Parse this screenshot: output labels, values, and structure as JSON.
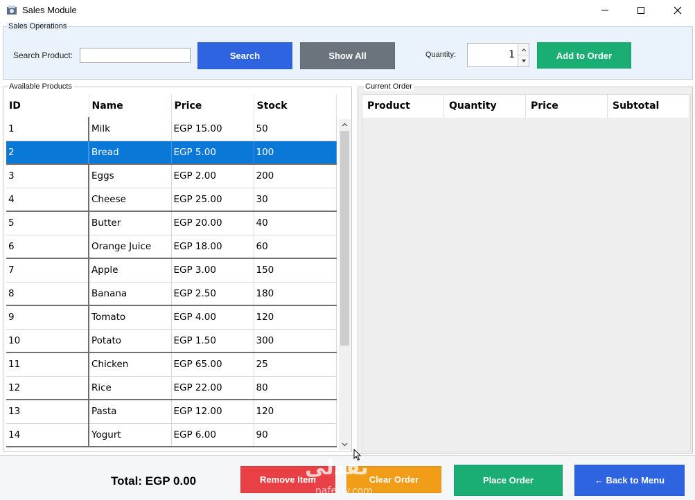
{
  "window": {
    "title": "Sales Module",
    "controls": [
      "minimize-icon",
      "maximize-icon",
      "close-icon"
    ]
  },
  "sales_operations": {
    "legend": "Sales Operations",
    "search_label": "Search Product:",
    "search_value": "",
    "search_button": "Search",
    "show_all_button": "Show All",
    "quantity_label": "Quantity:",
    "quantity_value": "1",
    "add_to_order_button": "Add to Order"
  },
  "available_products": {
    "legend": "Available Products",
    "columns": [
      "ID",
      "Name",
      "Price",
      "Stock"
    ],
    "selected_index": 1,
    "rows": [
      [
        "1",
        "Milk",
        "EGP 15.00",
        "50"
      ],
      [
        "2",
        "Bread",
        "EGP 5.00",
        "100"
      ],
      [
        "3",
        "Eggs",
        "EGP 2.00",
        "200"
      ],
      [
        "4",
        "Cheese",
        "EGP 25.00",
        "30"
      ],
      [
        "5",
        "Butter",
        "EGP 20.00",
        "40"
      ],
      [
        "6",
        "Orange Juice",
        "EGP 18.00",
        "60"
      ],
      [
        "7",
        "Apple",
        "EGP 3.00",
        "150"
      ],
      [
        "8",
        "Banana",
        "EGP 2.50",
        "180"
      ],
      [
        "9",
        "Tomato",
        "EGP 4.00",
        "120"
      ],
      [
        "10",
        "Potato",
        "EGP 1.50",
        "300"
      ],
      [
        "11",
        "Chicken",
        "EGP 65.00",
        "25"
      ],
      [
        "12",
        "Rice",
        "EGP 22.00",
        "80"
      ],
      [
        "13",
        "Pasta",
        "EGP 12.00",
        "120"
      ],
      [
        "14",
        "Yogurt",
        "EGP 6.00",
        "90"
      ]
    ]
  },
  "current_order": {
    "legend": "Current Order",
    "columns": [
      "Product",
      "Quantity",
      "Price",
      "Subtotal"
    ],
    "rows": []
  },
  "footer": {
    "total_text": "Total: EGP 0.00",
    "remove_item_button": "Remove Item",
    "clear_order_button": "Clear Order",
    "place_order_button": "Place Order",
    "back_to_menu_button": "← Back to Menu",
    "watermark_text": "نفذلي",
    "watermark_url": "nafezly.com"
  },
  "colors": {
    "search_button": "#2f64e0",
    "show_all_button": "#6b747c",
    "add_to_order_button": "#1aad74",
    "remove_item_button": "#e84044",
    "clear_order_button": "#f29d18",
    "place_order_button": "#1aad74",
    "back_to_menu_button": "#2f64e0",
    "selection": "#0a78d7"
  }
}
